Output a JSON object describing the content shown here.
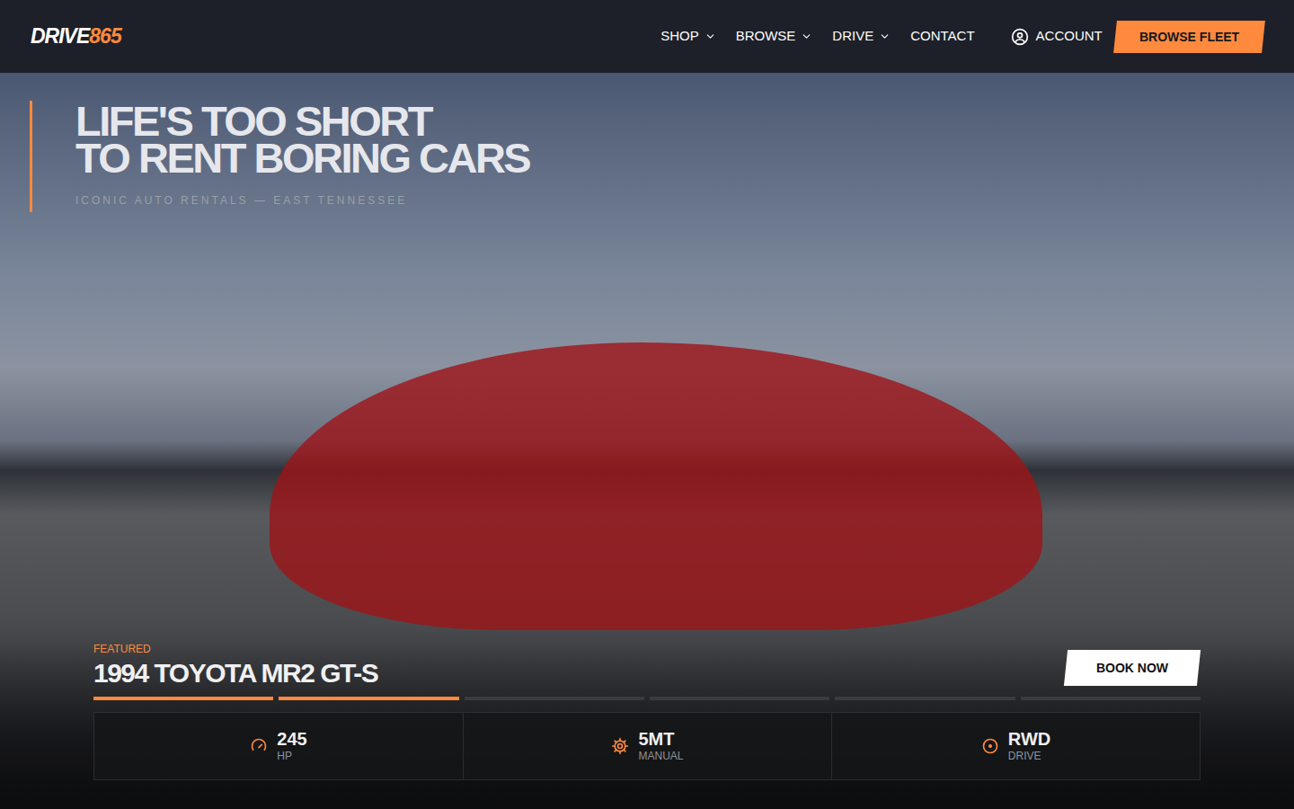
{
  "header": {
    "logo": {
      "primary": "DRIVE",
      "accent": "865"
    },
    "nav": [
      {
        "label": "SHOP",
        "has_menu": true
      },
      {
        "label": "BROWSE",
        "has_menu": true
      },
      {
        "label": "DRIVE",
        "has_menu": true
      },
      {
        "label": "CONTACT",
        "has_menu": false
      }
    ],
    "account": "ACCOUNT",
    "cta": "BROWSE FLEET"
  },
  "hero": {
    "headline": [
      "LIFE'S TOO SHORT",
      "TO RENT BORING CARS"
    ],
    "tagline": "ICONIC AUTO RENTALS — EAST TENNESSEE"
  },
  "featured": {
    "label": "FEATURED",
    "title": "1994 TOYOTA MR2 GT-S",
    "book": "BOOK NOW",
    "slides": [
      {
        "level": 1
      },
      {
        "level": 1
      },
      {
        "level": 0
      },
      {
        "level": 0
      },
      {
        "level": 0
      },
      {
        "level": 0
      }
    ],
    "specs": [
      {
        "value": "245",
        "label": "HP",
        "kind": "gauge"
      },
      {
        "value": "5MT",
        "label": "MANUAL",
        "kind": "gear"
      },
      {
        "value": "RWD",
        "label": "DRIVE",
        "kind": "target"
      }
    ]
  }
}
